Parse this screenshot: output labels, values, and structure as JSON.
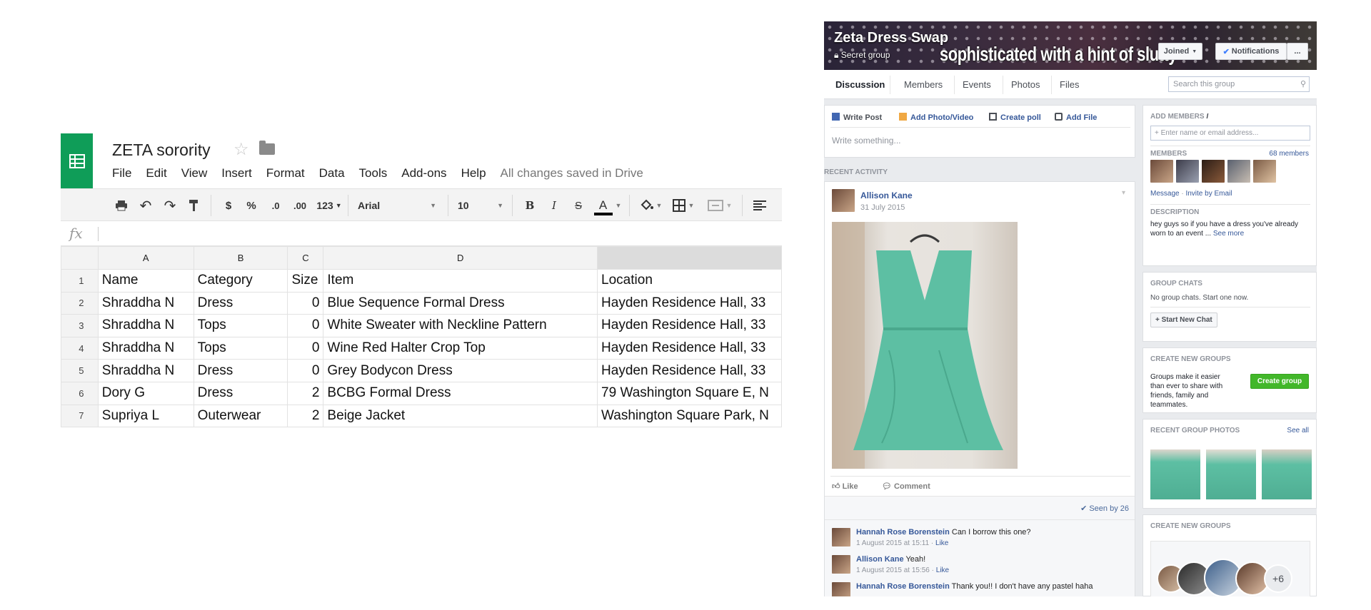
{
  "sheet": {
    "title": "ZETA sorority",
    "menu": [
      "File",
      "Edit",
      "View",
      "Insert",
      "Format",
      "Data",
      "Tools",
      "Add-ons",
      "Help"
    ],
    "saved_status": "All changes saved in Drive",
    "toolbar": {
      "currency": "$",
      "percent": "%",
      "decrease_decimals": ".0",
      "increase_decimals": ".00",
      "more_formats": "123",
      "font": "Arial",
      "font_size": "10",
      "bold": "B",
      "italic": "I",
      "strike": "S",
      "text_color": "A"
    },
    "formula_icon": "fx",
    "columns": [
      "A",
      "B",
      "C",
      "D"
    ],
    "rows": [
      {
        "num": "1",
        "cells": [
          "Name",
          "Category",
          "Size",
          "Item",
          "Location"
        ]
      },
      {
        "num": "2",
        "cells": [
          "Shraddha N",
          "Dress",
          "0",
          "Blue Sequence Formal Dress",
          "Hayden Residence Hall, 33"
        ]
      },
      {
        "num": "3",
        "cells": [
          "Shraddha N",
          "Tops",
          "0",
          "White Sweater with Neckline Pattern",
          "Hayden Residence Hall, 33"
        ]
      },
      {
        "num": "4",
        "cells": [
          "Shraddha N",
          "Tops",
          "0",
          "Wine Red Halter Crop Top",
          "Hayden Residence Hall, 33"
        ]
      },
      {
        "num": "5",
        "cells": [
          "Shraddha N",
          "Dress",
          "0",
          "Grey Bodycon Dress",
          "Hayden Residence Hall, 33"
        ]
      },
      {
        "num": "6",
        "cells": [
          "Dory G",
          "Dress",
          "2",
          "BCBG Formal Dress",
          "79 Washington Square E, N"
        ]
      },
      {
        "num": "7",
        "cells": [
          "Supriya L",
          "Outerwear",
          "2",
          "Beige Jacket",
          "Washington Square Park, N"
        ]
      }
    ]
  },
  "fb": {
    "group_name": "Zeta Dress Swap",
    "privacy": "Secret group",
    "cover_tagline": "sophisticated with a hint of slutty",
    "joined_label": "Joined",
    "notifications_label": "Notifications",
    "more_label": "...",
    "tabs": [
      "Discussion",
      "Members",
      "Events",
      "Photos",
      "Files"
    ],
    "search_placeholder": "Search this group",
    "composer": {
      "write_post": "Write Post",
      "add_photo": "Add Photo/Video",
      "create_poll": "Create poll",
      "add_file": "Add File",
      "placeholder": "Write something..."
    },
    "recent_activity_label": "RECENT ACTIVITY",
    "post": {
      "author": "Allison Kane",
      "date": "31 July 2015",
      "like_label": "Like",
      "comment_label": "Comment",
      "seen_by": "Seen by 26"
    },
    "comments": [
      {
        "name": "Hannah Rose Borenstein",
        "text": "Can I borrow this one?",
        "meta": "1 August 2015 at 15:11 · ",
        "like": "Like"
      },
      {
        "name": "Allison Kane",
        "text": "Yeah!",
        "meta": "1 August 2015 at 15:56 · ",
        "like": "Like"
      },
      {
        "name": "Hannah Rose Borenstein",
        "text": "Thank you!! I don't have any pastel haha",
        "meta": "",
        "like": ""
      }
    ],
    "sidebar": {
      "add_members_label": "ADD MEMBERS",
      "add_members_placeholder": "+ Enter name or email address...",
      "members_label": "MEMBERS",
      "members_count": "68 members",
      "message_link": "Message",
      "invite_link": "Invite by Email",
      "description_label": "DESCRIPTION",
      "description_text": "hey guys so if you have a dress you've already worn to an event ...",
      "see_more": "See more",
      "group_chats_label": "GROUP CHATS",
      "group_chats_text": "No group chats. Start one now.",
      "start_chat": "+ Start New Chat",
      "create_groups_label": "CREATE NEW GROUPS",
      "create_groups_text": "Groups make it easier than ever to share with friends, family and teammates.",
      "create_group_button": "Create group",
      "recent_photos_label": "RECENT GROUP PHOTOS",
      "see_all": "See all",
      "create_groups_label_2": "CREATE NEW GROUPS",
      "suggest_more": "+6"
    },
    "colors": {
      "link": "#365899",
      "green_button": "#42b72a",
      "dress": "#5dbfa3"
    }
  }
}
